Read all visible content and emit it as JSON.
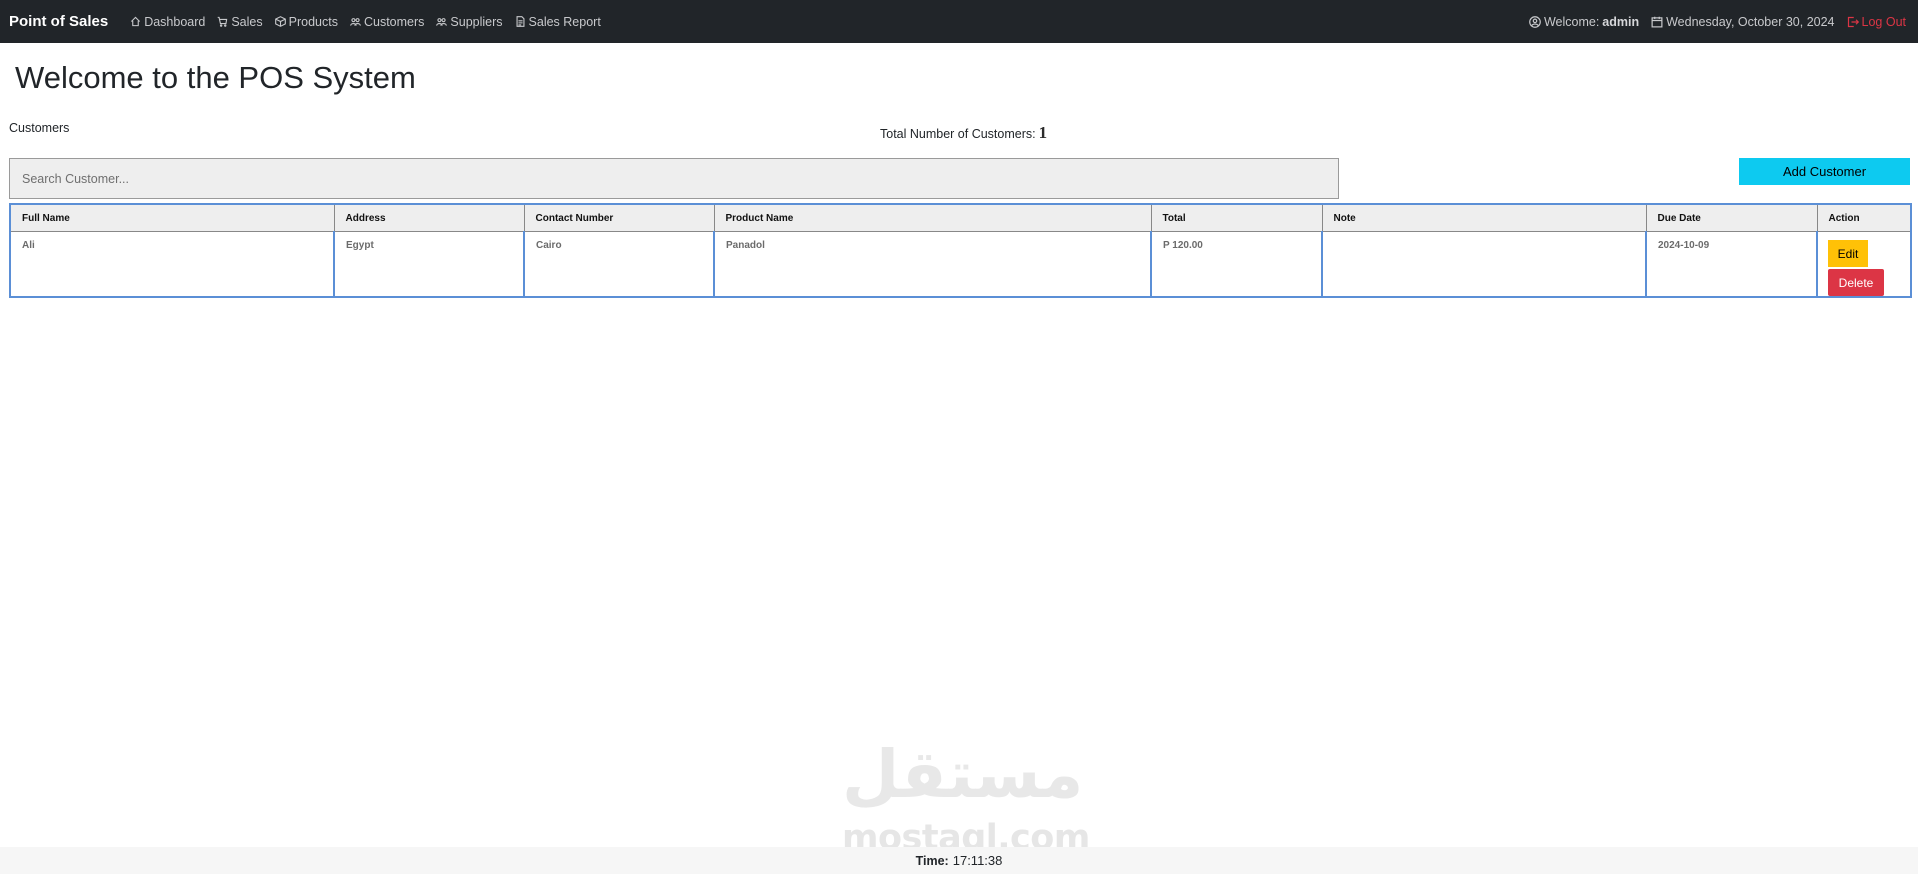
{
  "navbar": {
    "brand": "Point of Sales",
    "items": [
      {
        "label": "Dashboard",
        "icon": "house-icon"
      },
      {
        "label": "Sales",
        "icon": "cart-icon"
      },
      {
        "label": "Products",
        "icon": "box-icon"
      },
      {
        "label": "Customers",
        "icon": "people-icon"
      },
      {
        "label": "Suppliers",
        "icon": "people-icon"
      },
      {
        "label": "Sales Report",
        "icon": "file-icon"
      }
    ],
    "welcome_label": "Welcome:",
    "username": "admin",
    "date": "Wednesday, October 30, 2024",
    "logout_label": "Log Out",
    "colors": {
      "bg": "#212529",
      "logout": "#dc3545"
    }
  },
  "page": {
    "title": "Welcome to the POS System",
    "section_label": "Customers",
    "total_label": "Total Number of Customers:",
    "total_value": "1"
  },
  "search": {
    "placeholder": "Search Customer...",
    "value": ""
  },
  "add_button": {
    "label": "Add Customer",
    "color": "#0dcaf0"
  },
  "table": {
    "headers": [
      "Full Name",
      "Address",
      "Contact Number",
      "Product Name",
      "Total",
      "Note",
      "Due Date",
      "Action"
    ],
    "rows": [
      {
        "full_name": "Ali",
        "address": "Egypt",
        "contact": "Cairo",
        "product": "Panadol",
        "total": "P 120.00",
        "note": "",
        "due_date": "2024-10-09"
      }
    ],
    "actions": {
      "edit": "Edit",
      "delete": "Delete"
    }
  },
  "watermark": {
    "arabic": "مستقل",
    "latin": "mostaql.com"
  },
  "footer": {
    "time_label": "Time:",
    "time_value": "17:11:38"
  }
}
